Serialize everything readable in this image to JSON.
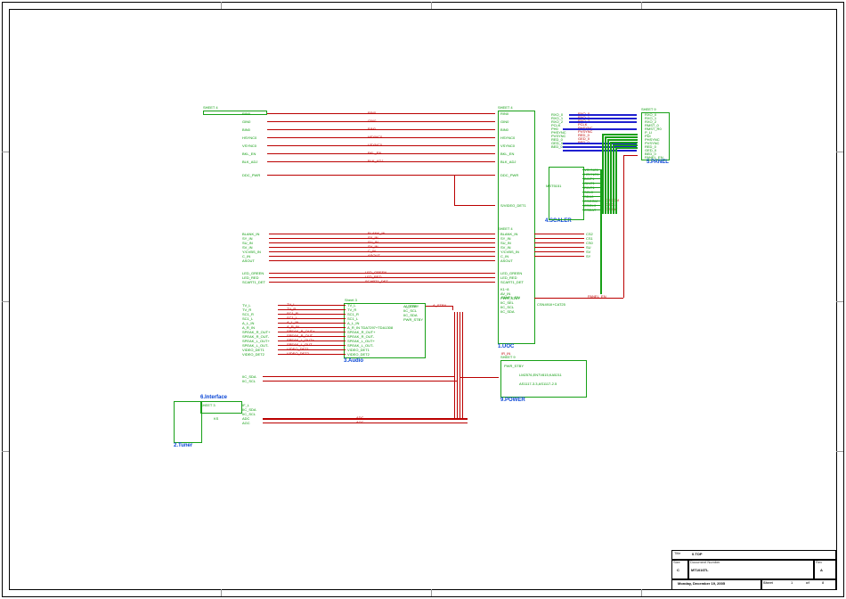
{
  "titleblock": {
    "title_label": "Title",
    "title": "0.TOP",
    "docnum_label": "Document Number",
    "docnum": "MT1016TL",
    "size_label": "Size",
    "size": "C",
    "rev_label": "Rev",
    "rev": "A",
    "date": "Monday, December 19, 2005",
    "sheet_label": "Sheet",
    "sheet_of": "of",
    "sheet_num": "1",
    "sheet_total": "8"
  },
  "blocks": {
    "tuner": {
      "title": "2.Tuner",
      "sheetref": "SHEET 2"
    },
    "interface": {
      "title": "6.Interface"
    },
    "audio": {
      "title": "3.Audio",
      "sheetref": "Sheet 3"
    },
    "uoc": {
      "title": "1.UOC",
      "sheetref": "SHEET 4",
      "sheetreflow": "SHEET 4"
    },
    "scaler": {
      "title": "4.SCALER",
      "refdes": "MST5151"
    },
    "panel": {
      "title": "5.PANEL",
      "sheetref": "SHEET 9"
    },
    "power": {
      "title": "9.POWER",
      "sheetref": "SHEET 9"
    }
  },
  "power_notes": {
    "line1": "LM2576,EN7V815,KA5211",
    "line2": "AS1117-3.3,AS1117-2.5"
  },
  "audio_notes": {
    "line1": "TDA7297+TDA1308"
  },
  "scaler_note": "CSN491II+CAT25",
  "panel_net": "PANEL_EN",
  "a_stby": "A_STBY",
  "uoc_left_a": {
    "sheet4": "SHEET 4",
    "items": [
      "RIN0",
      "GIN0",
      "BIN0",
      "HSYNC0",
      "VSYNC0",
      "BKL_EN",
      "BLK_ADJ",
      "DDC_PWR"
    ]
  },
  "net_mid_a": {
    "items": [
      "RIN0",
      "GIN0",
      "BIN0",
      "HSYNC0",
      "VSYNC0",
      "BKL_EN",
      "BLK_ADJ"
    ]
  },
  "uoc_right_a": {
    "items": [
      "RIN0",
      "GIN0",
      "BIN0",
      "HSYNC0",
      "VSYNC0",
      "BKL_EN",
      "BLK_ADJ",
      "DDC_PWR",
      "S/VIDEO_DET1"
    ]
  },
  "panel_left": {
    "items": [
      "RXO_0",
      "RXO_1",
      "RXO_2",
      "PCLK",
      "PH0",
      "PHSYNC",
      "PVSYNC",
      "RED_0",
      "GED_0",
      "BED_0"
    ]
  },
  "panel_right": {
    "items": [
      "RXO_0",
      "RXO_1",
      "RXO_2",
      "RMST_0",
      "RMST_R0",
      "P_LI",
      "PDI",
      "PHSYNC",
      "PVSYNC",
      "RED_0",
      "GED_0",
      "BED_0",
      "PANEL_EN"
    ]
  },
  "panel_nets": {
    "items": [
      "RXO_0",
      "RXO_1",
      "RXO_2",
      "PCLK",
      "PHSYNC",
      "PVSYNC",
      "RED_0",
      "GED_0",
      "BED_0"
    ]
  },
  "scaler_right": {
    "items": [
      "VSYNC1",
      "HSYNC1",
      "BINT1",
      "GINT1",
      "RINT1",
      "SCL0",
      "SDA0",
      "CSCOM",
      "CSCLK",
      "CSDAT"
    ]
  },
  "scaler_csnets": {
    "items": [
      "CSCOM",
      "CSCLK",
      "CSDAT"
    ]
  },
  "uoc_group_b_left": {
    "items": [
      "BLANK_IN",
      "SY_IN",
      "SU_IN",
      "SV_IN",
      "Y/CVBS_IN",
      "C_IN",
      "ASOUT"
    ]
  },
  "net_mid_b": {
    "items": [
      "BLANK_IN",
      "SY_IN",
      "SU_IN",
      "SV_IN",
      "C_IN",
      "ASOUT"
    ]
  },
  "uoc_group_b_right": {
    "items": [
      "BLANK_IN",
      "SY_IN",
      "SU_IN",
      "SV_IN",
      "Y/CVBS_IN",
      "C_IN",
      "ASOUT",
      "CS2",
      "CS1",
      "CS0",
      "SU",
      "SV",
      "SY"
    ]
  },
  "uoc_group_c_left": {
    "items": [
      "LED_GREEN",
      "LED_RED",
      "SCART1_DET"
    ]
  },
  "uoc_group_c_right": {
    "items": [
      "LED_GREEN",
      "LED_RED",
      "SCART1_DET",
      "K1~8",
      "AV_IN",
      "PWR_STBY",
      "IIC_SEL",
      "IIC_SCL",
      "IIC_SDA"
    ]
  },
  "net_mid_c": {
    "items": [
      "LED_GREEN",
      "LED_RED",
      "SCART1_DET"
    ]
  },
  "audio_left": {
    "items": [
      "TV_L",
      "TV_R",
      "SC1_R",
      "SC1_L",
      "A_L_IN",
      "A_R_IN",
      "SPEAK_R_OUT+",
      "SPEAK_R_OUT-",
      "SPEAK_L_OUT+",
      "SPEAK_L_OUT-",
      "VIDEO_DET1",
      "VIDEO_DET2"
    ]
  },
  "audio_net_mid": {
    "items": [
      "TV_L",
      "TV_R",
      "SC1_R",
      "SC1_L",
      "A_L_IN",
      "A_R_IN",
      "SPEAK_R_OUT+",
      "SPEAK_R_OUT-",
      "SPEAK_L_OUT+",
      "SPEAK_L_OUT-",
      "VIDEO_DET1",
      "VIDEO_DET2"
    ]
  },
  "audio_ports": {
    "items": [
      "TV_L",
      "TV_R",
      "SC1_R",
      "SC1_L",
      "A_L_IN",
      "A_R_IN",
      "SPEAK_R_OUT+",
      "SPEAK_R_OUT-",
      "SPEAK_L_OUT+",
      "SPEAK_L_OUT-",
      "VIDEO_DET1",
      "VIDEO_DET2"
    ]
  },
  "audio_right": {
    "items": [
      "A_STBY",
      "IIC_SCL",
      "IIC_SDA",
      "PWR_STBY"
    ]
  },
  "interface_left": {
    "items": [
      "IIC_SDA",
      "IIC_SCL"
    ]
  },
  "tuner_left": {
    "items": [
      "IF_L",
      "IIC_SDA",
      "IIC_SCL",
      "ADC",
      "AGC"
    ]
  },
  "tuner_mid": {
    "items": [
      "ADC",
      "AGC"
    ]
  },
  "power_ports": {
    "items": [
      "PWR_STBY"
    ]
  },
  "uoc_low_right": {
    "items": [
      "IR_IN"
    ]
  }
}
